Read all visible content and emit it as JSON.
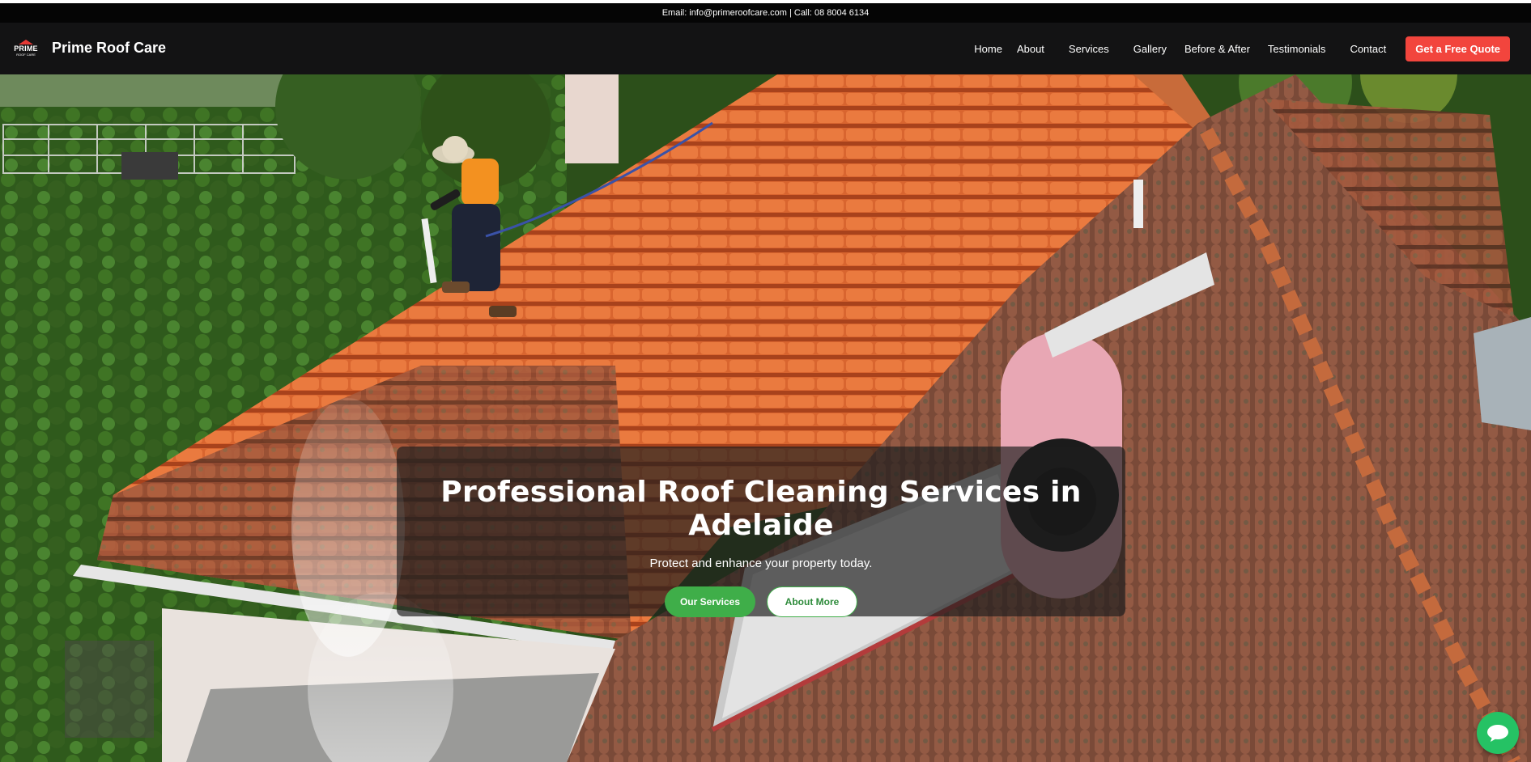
{
  "topbar": {
    "contact_text": "Email: info@primeroofcare.com | Call: 08 8004 6134"
  },
  "brand": {
    "logo_line1": "PRIME",
    "logo_line2": "ROOF CARE",
    "name": "Prime Roof Care"
  },
  "nav": {
    "items": [
      {
        "label": "Home"
      },
      {
        "label": "About"
      },
      {
        "label": "Services"
      },
      {
        "label": "Gallery"
      },
      {
        "label": "Before & After"
      },
      {
        "label": "Testimonials"
      },
      {
        "label": "Contact"
      }
    ],
    "cta_label": "Get a Free Quote"
  },
  "hero": {
    "title": "Professional Roof Cleaning Services in Adelaide",
    "subtitle": "Protect and enhance your property today.",
    "primary_button": "Our Services",
    "secondary_button": "About More"
  },
  "colors": {
    "accent_red": "#f2453d",
    "accent_green": "#3fae49",
    "navbar_bg": "#131314"
  },
  "icons": {
    "chat": "chat-bubble-icon",
    "logo": "roof-logo-icon"
  }
}
